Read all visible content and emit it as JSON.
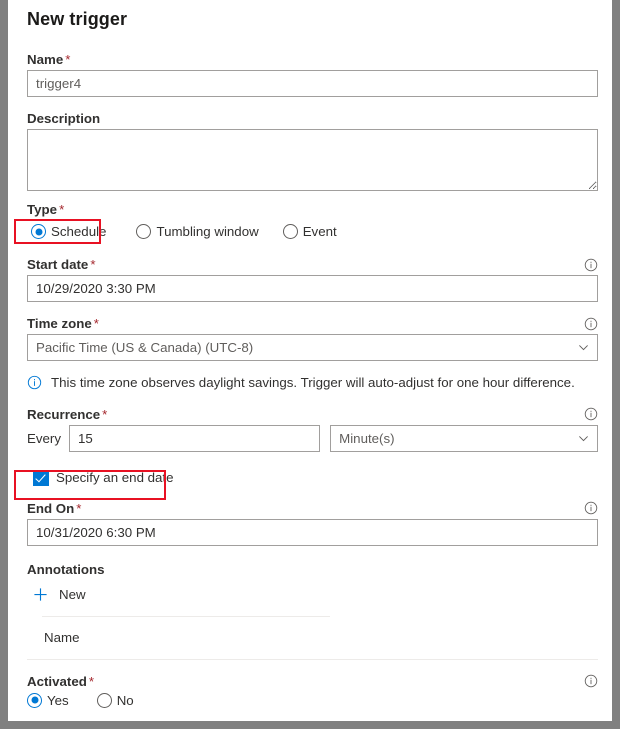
{
  "panel": {
    "title": "New trigger",
    "required_marker": "*"
  },
  "name_field": {
    "label": "Name",
    "required": true,
    "value": "trigger4",
    "placeholder": "trigger4"
  },
  "description_field": {
    "label": "Description",
    "required": false,
    "value": "",
    "placeholder": ""
  },
  "type_field": {
    "label": "Type",
    "required": true,
    "selected": "Schedule",
    "options": [
      {
        "label": "Schedule",
        "checked": true,
        "highlighted": true
      },
      {
        "label": "Tumbling window",
        "checked": false,
        "highlighted": false
      },
      {
        "label": "Event",
        "checked": false,
        "highlighted": false
      }
    ]
  },
  "start_date_field": {
    "label": "Start date",
    "required": true,
    "value": "10/29/2020 3:30 PM",
    "info_icon": "info-circle-icon"
  },
  "time_zone_field": {
    "label": "Time zone",
    "required": true,
    "value": "Pacific Time (US & Canada) (UTC-8)",
    "info_icon": "info-circle-icon",
    "chevron_icon": "chevron-down-icon"
  },
  "daylight_notice": {
    "icon": "info-circle-icon",
    "text": "This time zone observes daylight savings. Trigger will auto-adjust for one hour difference."
  },
  "recurrence_field": {
    "label": "Recurrence",
    "required": true,
    "info_icon": "info-circle-icon",
    "every_label": "Every",
    "interval_value": "15",
    "unit_value": "Minute(s)",
    "chevron_icon": "chevron-down-icon"
  },
  "end_date_checkbox": {
    "label": "Specify an end date",
    "checked": true,
    "highlighted": true
  },
  "end_on_field": {
    "label": "End On",
    "required": true,
    "value": "10/31/2020 6:30 PM",
    "info_icon": "info-circle-icon"
  },
  "annotations": {
    "label": "Annotations",
    "new_button_label": "New",
    "new_button_icon": "plus-icon",
    "table": {
      "columns": [
        "Name"
      ],
      "rows": []
    }
  },
  "activated_field": {
    "label": "Activated",
    "required": true,
    "info_icon": "info-circle-icon",
    "selected": "Yes",
    "options": [
      {
        "label": "Yes",
        "checked": true
      },
      {
        "label": "No",
        "checked": false
      }
    ]
  },
  "colors": {
    "accent": "#0078d4",
    "required_asterisk": "#a4262c",
    "highlight": "#e81123",
    "border": "#a19f9d",
    "frame": "#808080",
    "text": "#323130"
  }
}
